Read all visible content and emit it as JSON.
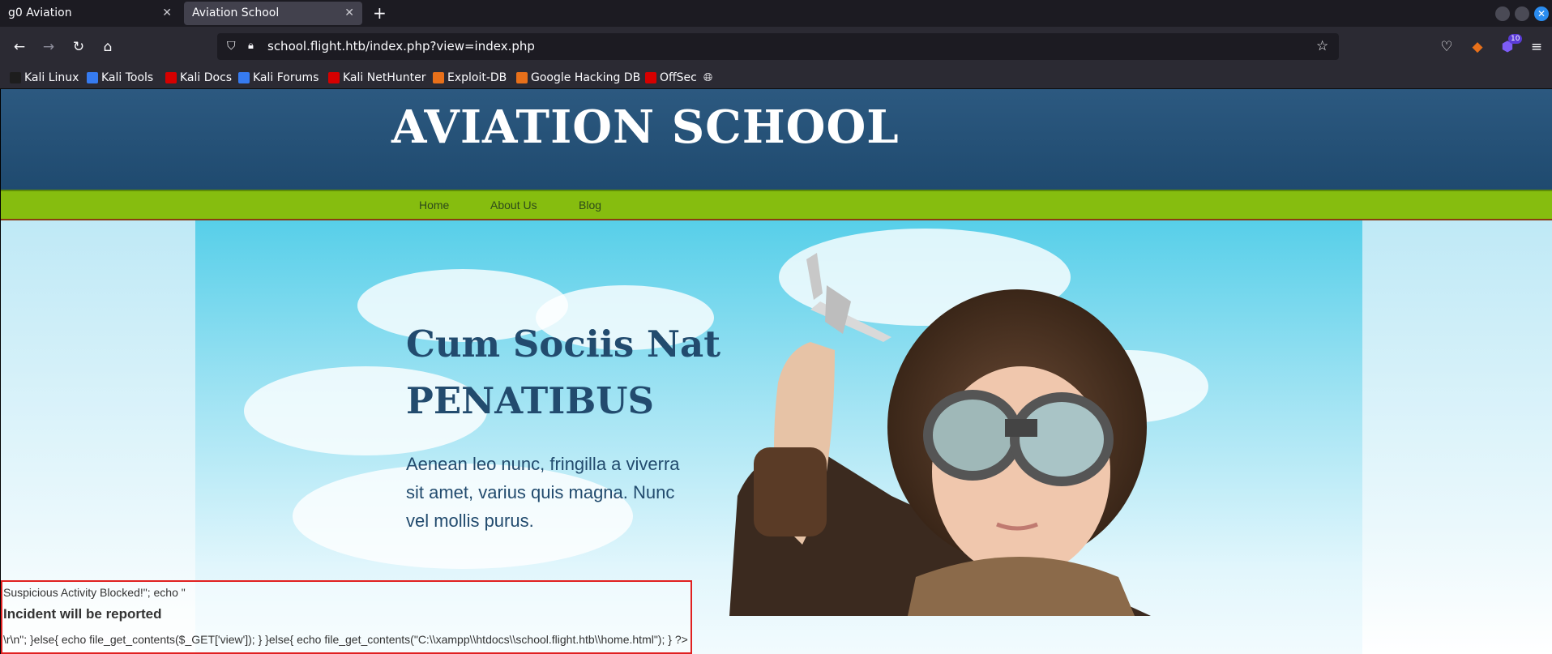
{
  "browser": {
    "tabs": [
      {
        "title": "g0 Aviation",
        "active": false
      },
      {
        "title": "Aviation School",
        "active": true
      }
    ],
    "url": "school.flight.htb/index.php?view=index.php",
    "extension_badge": "10",
    "bookmarks": [
      {
        "label": "Kali Linux",
        "color": "#1d1d1d"
      },
      {
        "label": "Kali Tools",
        "color": "#367bf0"
      },
      {
        "label": "Kali Docs",
        "color": "#d60000"
      },
      {
        "label": "Kali Forums",
        "color": "#367bf0"
      },
      {
        "label": "Kali NetHunter",
        "color": "#d60000"
      },
      {
        "label": "Exploit-DB",
        "color": "#e8701a"
      },
      {
        "label": "Google Hacking DB",
        "color": "#e8701a"
      },
      {
        "label": "OffSec",
        "color": "#d60000"
      }
    ]
  },
  "site": {
    "title": "AVIATION SCHOOL",
    "menu": [
      "Home",
      "About Us",
      "Blog"
    ],
    "hero": {
      "heading_line1": "Cum Sociis Nat",
      "heading_line2": "PENATIBUS",
      "text": "Aenean leo nunc, fringilla a viverra sit amet, varius quis magna. Nunc vel mollis purus."
    },
    "blocked": {
      "line1": "Suspicious Activity Blocked!\"; echo \"",
      "line2": "Incident will be reported",
      "line3": "\\r\\n\"; }else{ echo file_get_contents($_GET['view']); } }else{ echo file_get_contents(\"C:\\\\xampp\\\\htdocs\\\\school.flight.htb\\\\home.html\"); } ?>"
    }
  }
}
